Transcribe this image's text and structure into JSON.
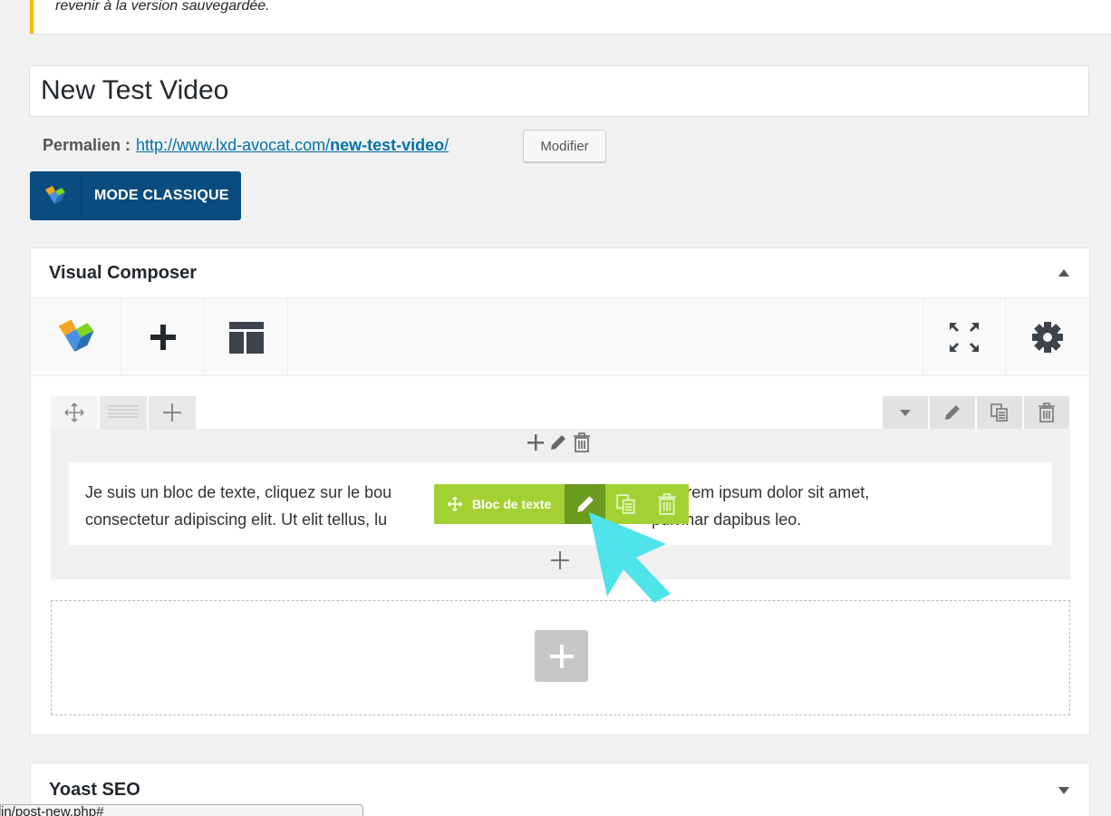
{
  "notice": {
    "text": "revenir à la version sauvegardée."
  },
  "post": {
    "title": "New Test Video",
    "permalink_label": "Permalien :",
    "permalink_base": "http://www.lxd-avocat.com/",
    "permalink_slug": "new-test-video",
    "permalink_trailing": "/",
    "modify_button": "Modifier"
  },
  "classic_mode_button": "MODE CLASSIQUE",
  "visual_composer": {
    "title": "Visual Composer",
    "text_block": "Je suis un bloc de texte, cliquez sur le bouton modifier pour changer ce texte. Lorem ipsum dolor sit amet, consectetur adipiscing elit. Ut elit tellus, luctus nec ullamcorper mattis, pulvinar dapibus leo.",
    "text_block_line1_a": "Je suis un bloc de texte, cliquez sur le bou",
    "text_block_line1_b": "er. Lorem ipsum dolor sit amet,",
    "text_block_line2_a": "consectetur adipiscing elit. Ut elit tellus, lu",
    "text_block_line2_b": "pulvinar dapibus leo.",
    "element_label": "Bloc de texte"
  },
  "yoast": {
    "title": "Yoast SEO"
  },
  "status_bar": {
    "url": "in/post-new.php#"
  },
  "colors": {
    "accent_blue": "#0b4c80",
    "element_green": "#a3d133",
    "element_green_dark": "#6a9a1e",
    "cursor_cyan": "#4fe3ea",
    "notice_yellow": "#ffb900"
  }
}
